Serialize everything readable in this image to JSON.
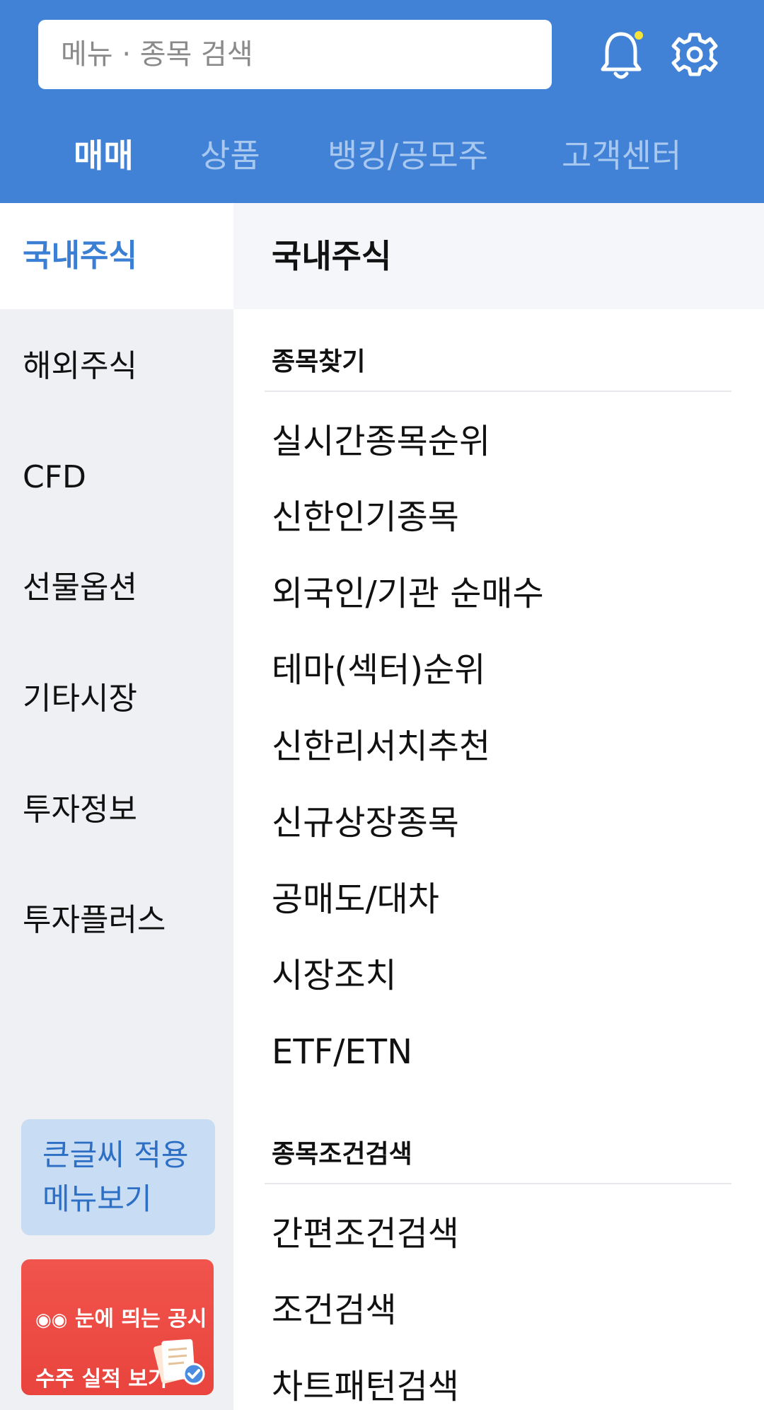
{
  "header": {
    "search_placeholder": "메뉴 · 종목 검색",
    "bell_icon": "bell-icon",
    "bell_dot_color": "#f5e23b",
    "settings_icon": "gear-icon",
    "tabs": [
      {
        "label": "매매",
        "active": true
      },
      {
        "label": "상품",
        "active": false
      },
      {
        "label": "뱅킹/공모주",
        "active": false
      },
      {
        "label": "고객센터",
        "active": false
      }
    ],
    "bg_color": "#4182d6"
  },
  "sidebar": {
    "items": [
      {
        "label": "국내주식",
        "active": true
      },
      {
        "label": "해외주식",
        "active": false
      },
      {
        "label": "CFD",
        "active": false
      },
      {
        "label": "선물옵션",
        "active": false
      },
      {
        "label": "기타시장",
        "active": false
      },
      {
        "label": "투자정보",
        "active": false
      },
      {
        "label": "투자플러스",
        "active": false
      }
    ],
    "bigfont_button": {
      "line1": "큰글씨 적용",
      "line2": "메뉴보기"
    },
    "promo": {
      "line1": "눈에 띄는 공시",
      "line2": "수주 실적 보기",
      "icon": "eyes-icon"
    }
  },
  "content": {
    "title": "국내주식",
    "sections": [
      {
        "title": "종목찾기",
        "items": [
          "실시간종목순위",
          "신한인기종목",
          "외국인/기관 순매수",
          "테마(섹터)순위",
          "신한리서치추천",
          "신규상장종목",
          "공매도/대차",
          "시장조치",
          "ETF/ETN"
        ]
      },
      {
        "title": "종목조건검색",
        "items": [
          "간편조건검색",
          "조건검색",
          "차트패턴검색"
        ]
      }
    ]
  },
  "colors": {
    "accent": "#3b7fd5",
    "sidebar_bg": "#eff0f4",
    "bigfont_bg": "#c8dcf4",
    "promo_bg": "#ee4c44"
  }
}
